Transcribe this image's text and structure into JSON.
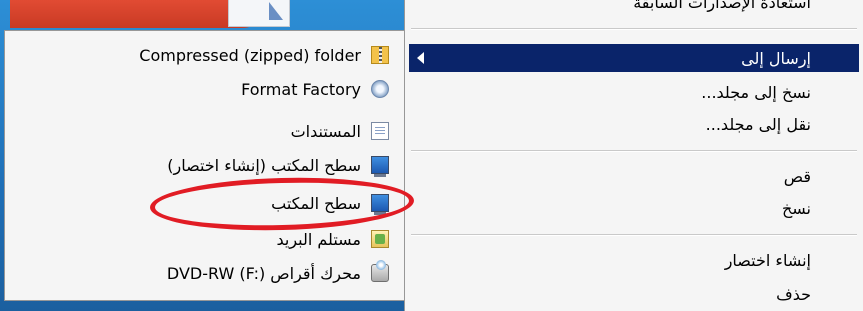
{
  "colors": {
    "selection": "#0a246a",
    "highlight_ellipse": "#e11c24",
    "menu_bg": "#f5f5f5"
  },
  "main_menu": {
    "top_partial": "استعادة الإصدارات السابقة",
    "items": [
      {
        "label": "إرسال إلى",
        "selected": true,
        "submenu_arrow": true
      },
      {
        "label": "نسخ إلى مجلد..."
      },
      {
        "label": "نقل إلى مجلد..."
      },
      {
        "label": "قص"
      },
      {
        "label": "نسخ"
      },
      {
        "label": "إنشاء اختصار"
      },
      {
        "label": "حذف"
      }
    ]
  },
  "send_to_menu": {
    "items": [
      {
        "label": "Compressed (zipped) folder",
        "icon": "zip-folder-icon"
      },
      {
        "label": "Format Factory",
        "icon": "format-factory-icon"
      },
      {
        "label": "المستندات",
        "icon": "documents-icon"
      },
      {
        "label": "سطح المكتب (إنشاء اختصار)",
        "icon": "desktop-icon"
      },
      {
        "label": "سطح المكتب",
        "icon": "desktop-icon",
        "highlighted": true
      },
      {
        "label": "مستلم البريد",
        "icon": "mail-recipient-icon"
      },
      {
        "label": "محرك أقراص DVD-RW (F:)",
        "icon": "dvd-drive-icon"
      }
    ]
  }
}
